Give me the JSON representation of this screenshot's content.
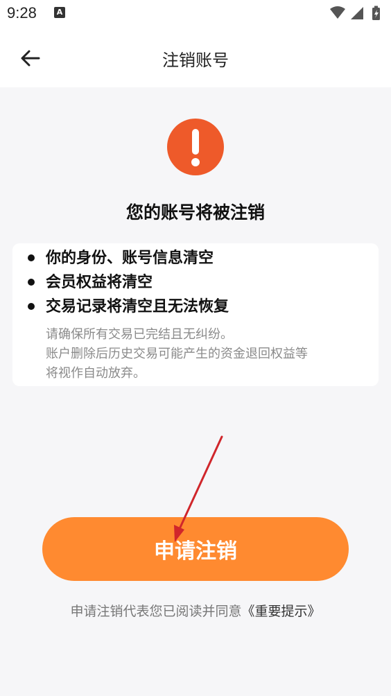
{
  "status_bar": {
    "time": "9:28",
    "notification_icon": "A"
  },
  "app_bar": {
    "title": "注销账号",
    "back_icon": "arrow-left-icon"
  },
  "warning": {
    "icon": "exclamation-icon",
    "icon_color": "#ee5a2a",
    "heading": "您的账号将被注销"
  },
  "consequences": {
    "items": [
      "你的身份、账号信息清空",
      "会员权益将清空",
      "交易记录将清空且无法恢复"
    ],
    "note_lines": [
      "请确保所有交易已完结且无纠纷。",
      "账户删除后历史交易可能产生的资金退回权益等",
      "将视作自动放弃。"
    ]
  },
  "actions": {
    "apply_label": "申请注销",
    "apply_color": "#ff8a30"
  },
  "agreement": {
    "prefix": "申请注销代表您已阅读并同意",
    "link_text": "《重要提示》"
  },
  "annotation": {
    "arrow_color": "#d0262b"
  }
}
